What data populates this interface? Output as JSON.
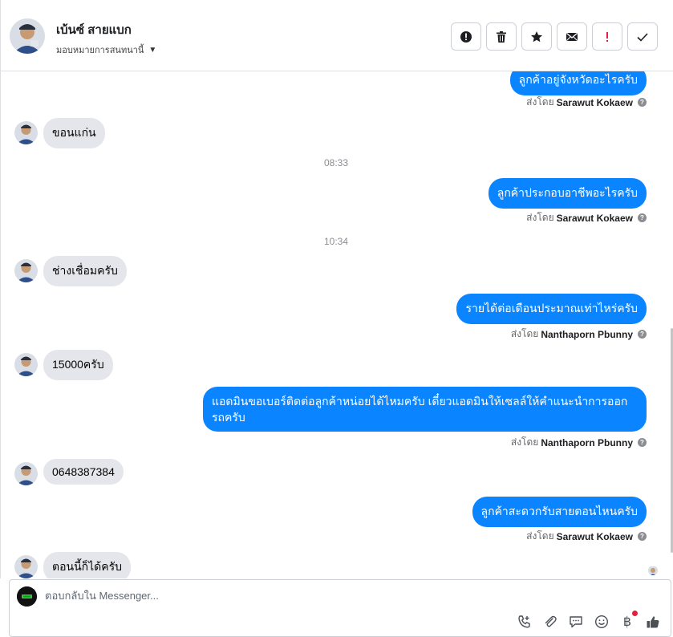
{
  "header": {
    "contact_name": "เบ้นซ์ สายแบก",
    "assign_label": "มอบหมายการสนทนานี้"
  },
  "messages": [
    {
      "kind": "out",
      "text": "ลูกค้าอยู่จังหวัดอะไรครับ",
      "sender_prefix": "ส่งโดย",
      "sender": "Sarawut Kokaew"
    },
    {
      "kind": "in",
      "text": "ขอนแก่น"
    },
    {
      "kind": "time",
      "text": "08:33"
    },
    {
      "kind": "out",
      "text": "ลูกค้าประกอบอาชีพอะไรครับ",
      "sender_prefix": "ส่งโดย",
      "sender": "Sarawut Kokaew"
    },
    {
      "kind": "time",
      "text": "10:34"
    },
    {
      "kind": "in",
      "text": "ช่างเชื่อมครับ"
    },
    {
      "kind": "out",
      "text": "รายได้ต่อเดือนประมาณเท่าไหร่ครับ",
      "sender_prefix": "ส่งโดย",
      "sender": "Nanthaporn Pbunny"
    },
    {
      "kind": "in",
      "text": "15000ครับ"
    },
    {
      "kind": "out",
      "text": "แอดมินขอเบอร์ติดต่อลูกค้าหน่อยได้ไหมครับ เดี๋ยวแอดมินให้เซลล์ให้คำแนะนำการออกรถครับ",
      "sender_prefix": "ส่งโดย",
      "sender": "Nanthaporn Pbunny"
    },
    {
      "kind": "in",
      "text": "0648387384"
    },
    {
      "kind": "out",
      "text": "ลูกค้าสะดวกรับสายตอนไหนครับ",
      "sender_prefix": "ส่งโดย",
      "sender": "Sarawut Kokaew"
    },
    {
      "kind": "in",
      "text": "ตอนนี้ก็ได้ครับ"
    }
  ],
  "composer": {
    "placeholder": "ตอบกลับใน Messenger...",
    "currency_symbol": "฿"
  },
  "icons": {
    "actions": [
      "alert-icon",
      "trash-icon",
      "star-icon",
      "envelope-icon",
      "exclamation-icon",
      "check-icon"
    ],
    "tools": [
      "phone-plus-icon",
      "paperclip-icon",
      "chat-bubble-icon",
      "smiley-icon",
      "baht-icon",
      "thumbs-up-icon"
    ]
  },
  "colors": {
    "outgoing_bubble": "#0b84ff",
    "incoming_bubble": "#e4e6eb",
    "alert_red": "#e41e3f"
  }
}
